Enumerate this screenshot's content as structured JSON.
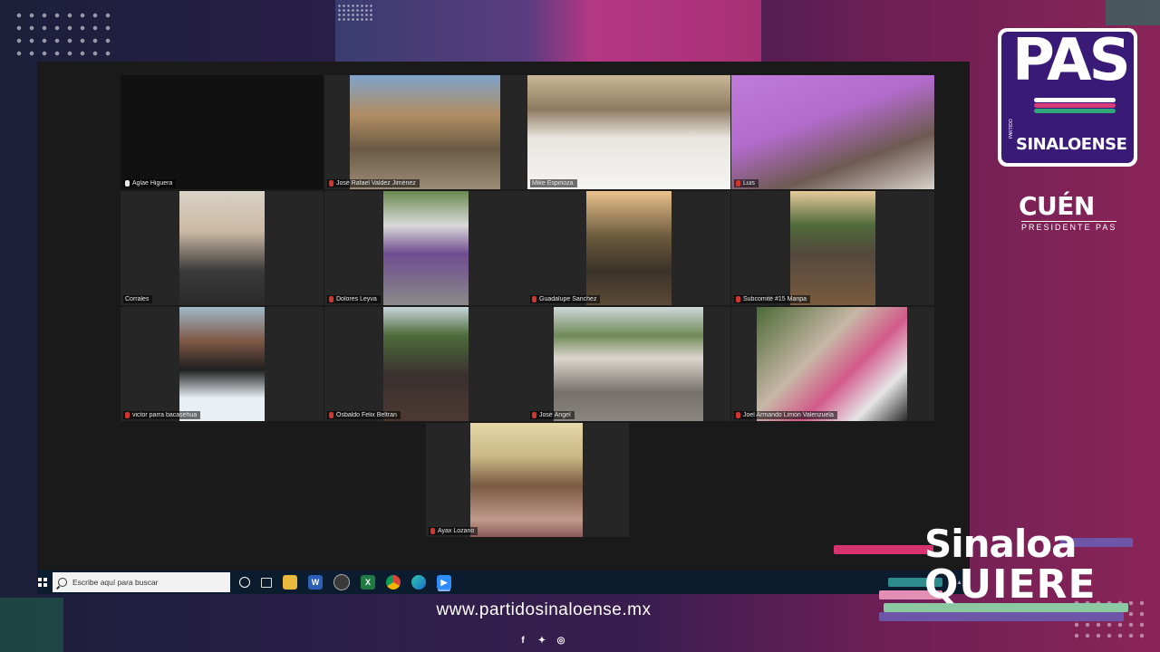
{
  "participants": [
    {
      "name": "Aglae Higuera",
      "mic_muted": false
    },
    {
      "name": "José Rafael Valdez Jiménez",
      "mic_muted": true
    },
    {
      "name": "Mike Espinoza",
      "mic_muted": false
    },
    {
      "name": "Luis",
      "mic_muted": true
    },
    {
      "name": "Corrales",
      "mic_muted": false
    },
    {
      "name": "Dolores Leyva",
      "mic_muted": true
    },
    {
      "name": "Guadalupe Sanchez",
      "mic_muted": true
    },
    {
      "name": "Subcomité #15 Maripa",
      "mic_muted": true
    },
    {
      "name": "victor parra bacasehua",
      "mic_muted": true
    },
    {
      "name": "Osbaldo Felix Beltran",
      "mic_muted": true
    },
    {
      "name": "José Ángel",
      "mic_muted": true
    },
    {
      "name": "Joel Armando Limón Valenzuela",
      "mic_muted": true
    },
    {
      "name": "Ayax Lozano",
      "mic_muted": true
    }
  ],
  "taskbar": {
    "search_placeholder": "Escribe aquí para buscar",
    "apps": [
      "task-view-icon",
      "file-explorer-icon",
      "word-icon",
      "browser-icon",
      "excel-icon",
      "chrome-icon",
      "edge-icon",
      "zoom-icon"
    ]
  },
  "branding": {
    "pas_logo_text": "PAS",
    "pas_partido": "PARTIDO",
    "pas_sinaloense": "SINALOENSE",
    "cuen": "CUÉN",
    "cuen_sub": "PRESIDENTE PAS",
    "slogan_line1": "Sinaloa",
    "slogan_line2": "QUIERE",
    "website": "www.partidosinaloense.mx",
    "social_icons": [
      "facebook-icon",
      "twitter-icon",
      "instagram-icon"
    ]
  },
  "colors": {
    "active_speaker_border": "#d5d74a",
    "pas_purple": "#3a1a77",
    "muted_mic": "#d0362e",
    "zoom_blue": "#2d8cff"
  }
}
